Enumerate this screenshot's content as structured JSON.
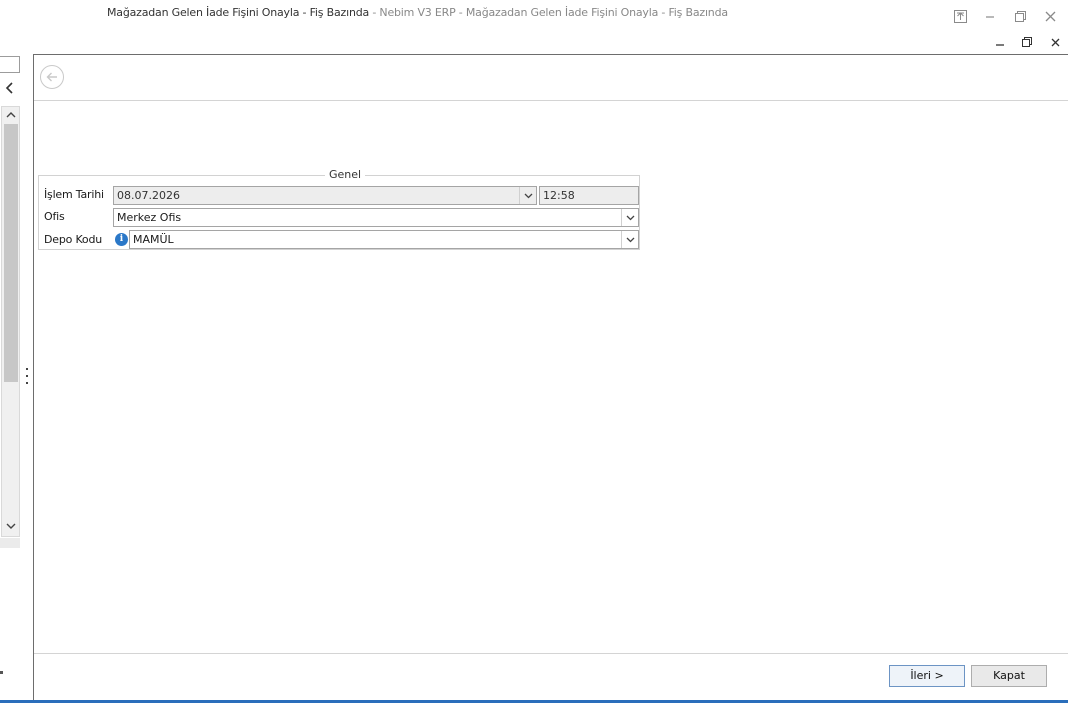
{
  "window": {
    "title_main": "Mağazadan Gelen İade Fişini Onayla - Fiş Bazında",
    "title_sub": " - Nebim V3 ERP - Mağazadan Gelen İade Fişini Onayla - Fiş Bazında"
  },
  "form": {
    "group_title": "Genel",
    "fields": {
      "islem_tarihi": {
        "label": "İşlem Tarihi",
        "date": "08.07.2026",
        "time": "12:58"
      },
      "ofis": {
        "label": "Ofis",
        "value": "Merkez Ofis"
      },
      "depo_kodu": {
        "label": "Depo Kodu",
        "value": "MAMÜL"
      }
    }
  },
  "buttons": {
    "next": "İleri >",
    "close": "Kapat"
  },
  "colors": {
    "accent": "#2a6ebb",
    "info": "#2b78c8"
  }
}
